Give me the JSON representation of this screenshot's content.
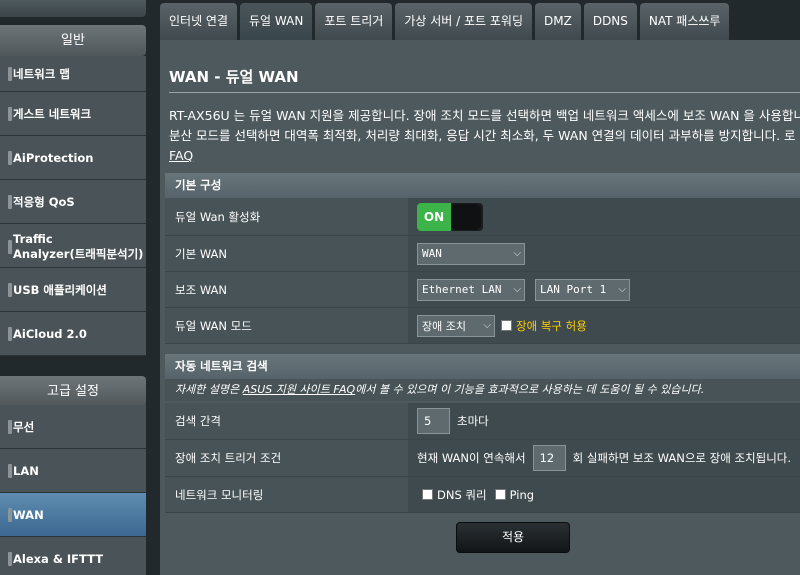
{
  "sidebar": {
    "general_header": "일반",
    "general_items": [
      {
        "label": "네트워크 맵"
      },
      {
        "label": "게스트 네트워크"
      },
      {
        "label": "AiProtection"
      },
      {
        "label": "적응형 QoS"
      },
      {
        "label_line1": "Traffic",
        "label_line2": "Analyzer(트래픽분석기)"
      },
      {
        "label": "USB 애플리케이션"
      },
      {
        "label": "AiCloud 2.0"
      }
    ],
    "advanced_header": "고급 설정",
    "advanced_items": [
      {
        "label": "무선"
      },
      {
        "label": "LAN"
      },
      {
        "label": "WAN",
        "active": true
      },
      {
        "label": "Alexa & IFTTT"
      }
    ]
  },
  "tabs": [
    {
      "label": "인터넷 연결"
    },
    {
      "label": "듀얼 WAN",
      "active": true
    },
    {
      "label": "포트 트리거"
    },
    {
      "label": "가상 서버 / 포트 포워딩"
    },
    {
      "label": "DMZ"
    },
    {
      "label": "DDNS"
    },
    {
      "label": "NAT 패스쓰루"
    }
  ],
  "page": {
    "title": "WAN - 듀얼 WAN",
    "description_line1": "RT-AX56U 는 듀얼 WAN 지원을 제공합니다. 장애 조치 모드를 선택하면 백업 네트워크 액세스에 보조 WAN 을 사용합니",
    "description_line2": "분산 모드를 선택하면 대역폭 최적화, 처리량 최대화, 응답 시간 최소화, 두 WAN 연결의 데이터 과부하를 방지합니다. 로",
    "faq_link": "FAQ"
  },
  "basic": {
    "section_title": "기본 구성",
    "enable_label": "듀얼 Wan 활성화",
    "enable_toggle": "ON",
    "primary_label": "기본 WAN",
    "primary_value": "WAN",
    "secondary_label": "보조 WAN",
    "secondary_value": "Ethernet LAN",
    "secondary_port": "LAN Port 1",
    "mode_label": "듀얼 WAN 모드",
    "mode_value": "장애 조치",
    "failback_label": "장애 복구 허용"
  },
  "auto": {
    "section_title": "자동 네트워크 검색",
    "hint_prefix": "자세한 설명은 ",
    "hint_link": "ASUS 지원 사이트 FAQ",
    "hint_suffix": "에서 볼 수 있으며 이 기능을 효과적으로 사용하는 데 도움이 될 수 있습니다.",
    "interval_label": "검색 간격",
    "interval_value": "5",
    "interval_unit": "초마다",
    "trigger_label": "장애 조치 트리거 조건",
    "trigger_prefix": "현재 WAN이 연속해서",
    "trigger_value": "12",
    "trigger_suffix": "회 실패하면 보조 WAN으로 장애 조치됩니다.",
    "monitor_label": "네트워크 모니터링",
    "monitor_dns": "DNS 쿼리",
    "monitor_ping": "Ping"
  },
  "apply_label": "적용",
  "colors": {
    "toggle_on": "#3cb44a",
    "active_nav": "#3c6891",
    "warn_text": "#ffcc00"
  }
}
